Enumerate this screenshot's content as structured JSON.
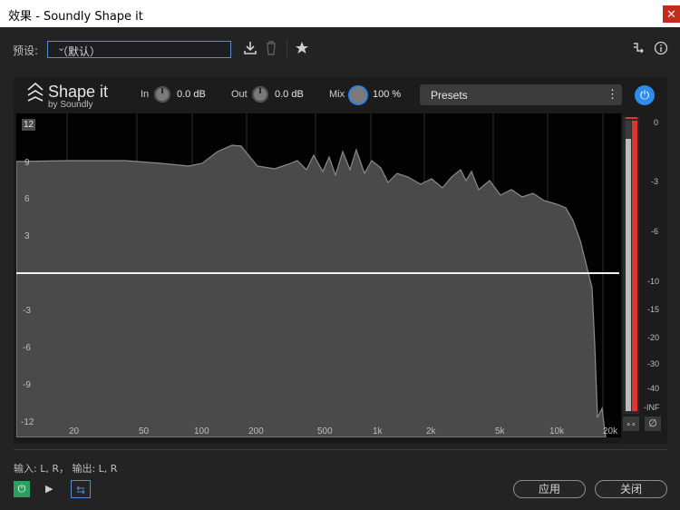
{
  "window": {
    "title": "效果 - Soundly Shape it",
    "close_glyph": "✕"
  },
  "preset_row": {
    "label": "预设:",
    "selected": "（默认）",
    "icons": [
      "download-icon",
      "trash-icon",
      "star-icon",
      "routing-icon",
      "info-icon"
    ]
  },
  "plugin": {
    "brand": "Shape it",
    "by": "by Soundly",
    "in_label": "In",
    "in_value": "0.0 dB",
    "out_label": "Out",
    "out_value": "0.0 dB",
    "mix_label": "Mix",
    "mix_value": "100 %",
    "presets_label": "Presets",
    "accent_color": "#2d8cf0"
  },
  "graph": {
    "y_badge": "12",
    "y_ticks": [
      "9",
      "6",
      "3",
      "-3",
      "-6",
      "-9",
      "-12"
    ],
    "x_ticks": [
      "20",
      "50",
      "100",
      "200",
      "500",
      "1k",
      "2k",
      "5k",
      "10k",
      "20k"
    ]
  },
  "meter": {
    "ticks": [
      "0",
      "-3",
      "-6",
      "-10",
      "-15",
      "-20",
      "-30",
      "-40",
      "-INF"
    ],
    "link_glyph": "∘∘",
    "phase_glyph": "∅",
    "level_color": "#e0352b"
  },
  "bottom": {
    "io_text": "输入: L, R， 输出: L, R",
    "apply_label": "应用",
    "close_label": "关闭"
  }
}
